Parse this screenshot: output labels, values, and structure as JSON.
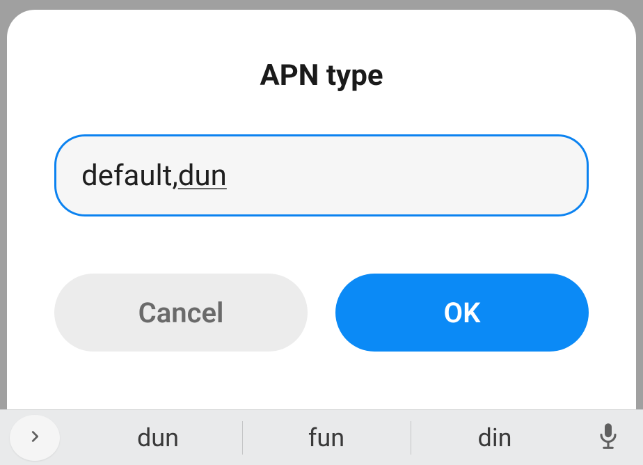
{
  "dialog": {
    "title": "APN type",
    "input_value_plain": "default,",
    "input_value_underlined": "dun",
    "cancel_label": "Cancel",
    "ok_label": "OK"
  },
  "keyboard": {
    "suggestions": [
      "dun",
      "fun",
      "din"
    ],
    "expand_icon": "chevron-right",
    "mic_icon": "microphone"
  },
  "colors": {
    "accent": "#0b8af6",
    "input_border": "#0b82f0",
    "cancel_bg": "#ececec",
    "cancel_fg": "#6a6a6a",
    "keyboard_bg": "#e9eaeb"
  }
}
